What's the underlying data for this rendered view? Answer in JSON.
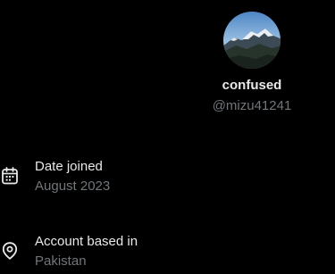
{
  "profile": {
    "display_name": "confused",
    "handle": "@mizu41241",
    "avatar_icon": "mountain-avatar"
  },
  "details": {
    "date_joined": {
      "label": "Date joined",
      "value": "August 2023",
      "icon": "calendar-icon"
    },
    "account_location": {
      "label": "Account based in",
      "value": "Pakistan",
      "icon": "location-pin-icon"
    }
  },
  "colors": {
    "background": "#000000",
    "primary_text": "#e7e9ea",
    "secondary_text": "#71767b"
  }
}
